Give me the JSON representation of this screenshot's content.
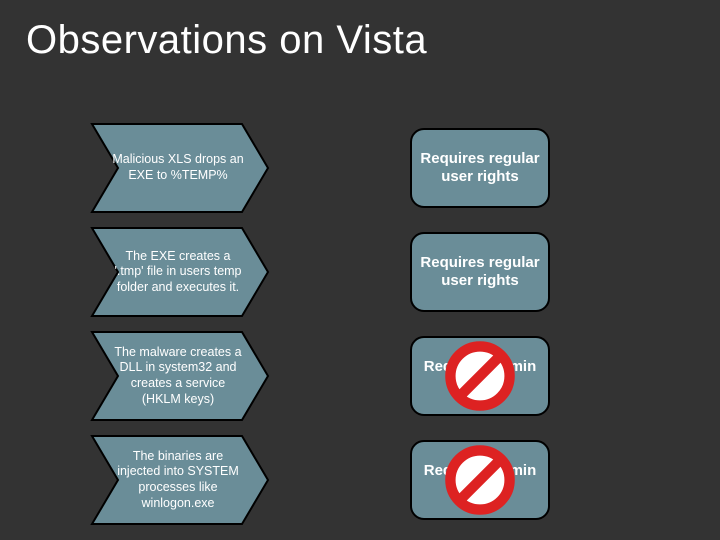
{
  "title": "Observations on Vista",
  "rows": [
    {
      "left": "Malicious XLS drops an EXE to %TEMP%",
      "right": "Requires regular user rights",
      "blocked": false
    },
    {
      "left": "The EXE creates a '.tmp' file in users temp folder and executes it.",
      "right": "Requires regular user rights",
      "blocked": false
    },
    {
      "left": "The malware creates a DLL in system32 and creates a service (HKLM keys)",
      "right": "Requires admin rights",
      "blocked": true
    },
    {
      "left": "The binaries are injected into SYSTEM processes like winlogon.exe",
      "right": "Requires admin rights",
      "blocked": true
    }
  ],
  "colors": {
    "shape_fill": "#6a8d98",
    "shape_stroke": "#000000"
  }
}
